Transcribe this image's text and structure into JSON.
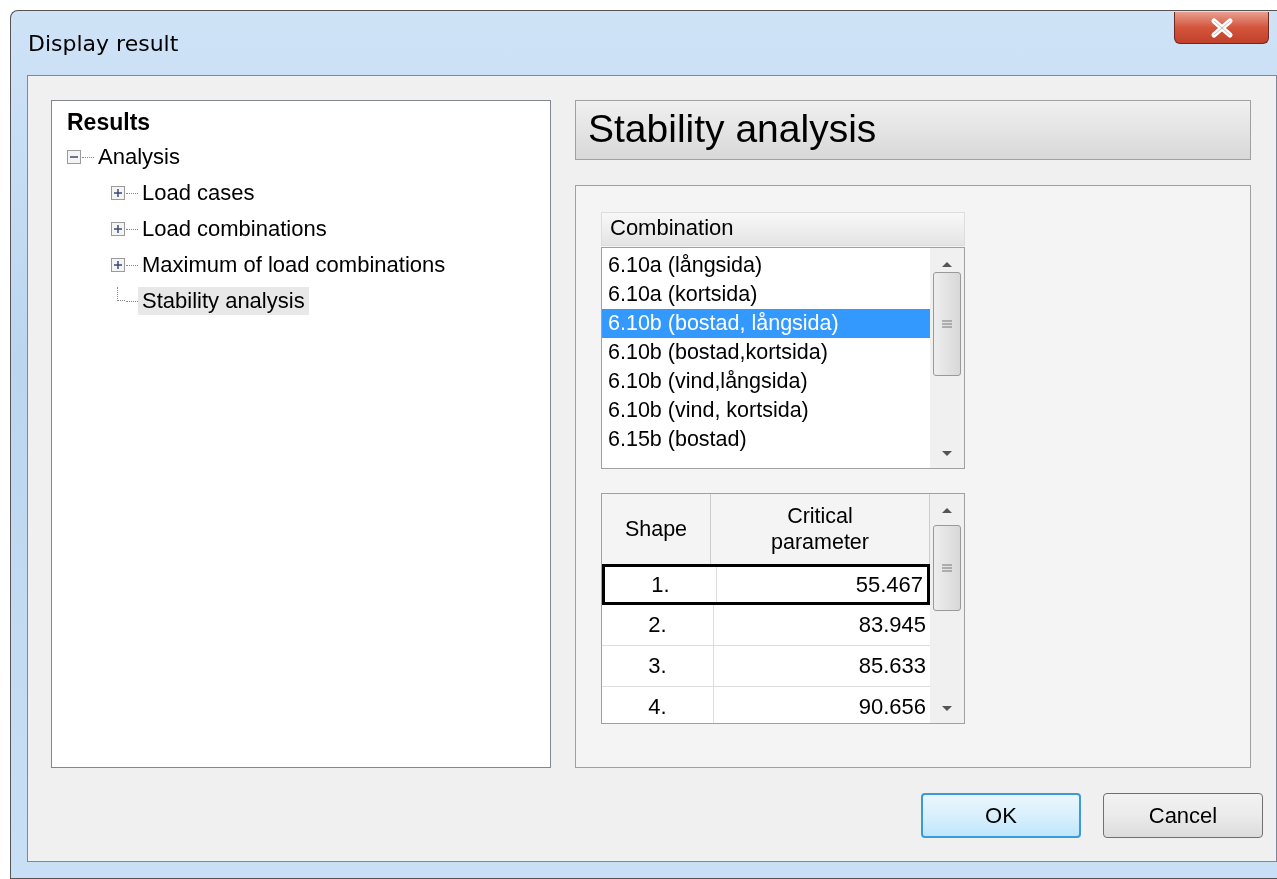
{
  "window": {
    "title": "Display result"
  },
  "tree": {
    "root": "Results",
    "items": [
      {
        "label": "Analysis",
        "kind": "folder",
        "expanded": true,
        "selected": false,
        "children": [
          {
            "label": "Load cases",
            "kind": "folder",
            "expanded": false,
            "selected": false
          },
          {
            "label": "Load combinations",
            "kind": "folder",
            "expanded": false,
            "selected": false
          },
          {
            "label": "Maximum of load combinations",
            "kind": "folder",
            "expanded": false,
            "selected": false
          },
          {
            "label": "Stability analysis",
            "kind": "leaf",
            "selected": true
          }
        ]
      }
    ]
  },
  "panel": {
    "title": "Stability analysis",
    "combination": {
      "header": "Combination",
      "items": [
        {
          "label": "6.10a (långsida)",
          "selected": false
        },
        {
          "label": "6.10a (kortsida)",
          "selected": false
        },
        {
          "label": "6.10b (bostad, långsida)",
          "selected": true
        },
        {
          "label": "6.10b (bostad,kortsida)",
          "selected": false
        },
        {
          "label": "6.10b (vind,långsida)",
          "selected": false
        },
        {
          "label": "6.10b (vind, kortsida)",
          "selected": false
        },
        {
          "label": "6.15b (bostad)",
          "selected": false
        }
      ]
    },
    "table": {
      "columns": [
        "Shape",
        "Critical parameter"
      ],
      "rows": [
        {
          "shape": "1.",
          "value": "55.467",
          "selected": true
        },
        {
          "shape": "2.",
          "value": "83.945",
          "selected": false
        },
        {
          "shape": "3.",
          "value": "85.633",
          "selected": false
        },
        {
          "shape": "4.",
          "value": "90.656",
          "selected": false
        }
      ]
    }
  },
  "buttons": [
    {
      "label": "OK",
      "default": true
    },
    {
      "label": "Cancel",
      "default": false
    }
  ]
}
